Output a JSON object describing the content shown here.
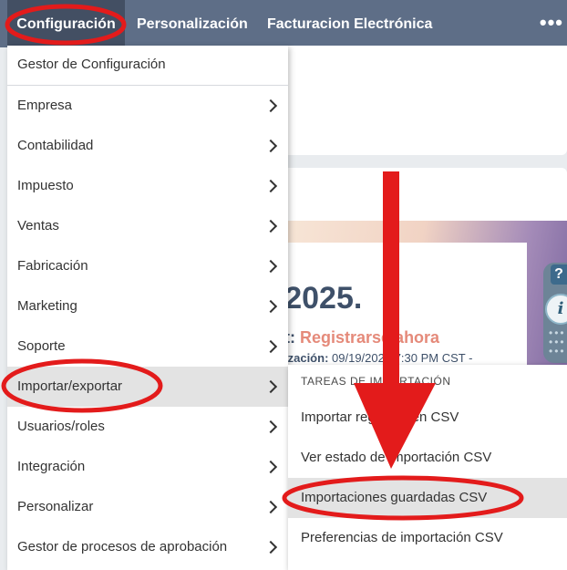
{
  "nav": {
    "items": [
      "Configuración",
      "Personalización",
      "Facturacion Electrónica"
    ],
    "more": "•••"
  },
  "background": {
    "title": "n 2025.",
    "promo_prefix": "t: ",
    "promo_link": "Registrarse ahora",
    "update_label": "ización:",
    "update_value": " 09/19/2025 7:30 PM CST -",
    "help": "?",
    "info": "i"
  },
  "menu": {
    "header": "Gestor de Configuración",
    "items": [
      "Empresa",
      "Contabilidad",
      "Impuesto",
      "Ventas",
      "Fabricación",
      "Marketing",
      "Soporte",
      "Importar/exportar",
      "Usuarios/roles",
      "Integración",
      "Personalizar",
      "Gestor de procesos de aprobación"
    ],
    "highlighted_index": 7
  },
  "submenu": {
    "header": "TAREAS DE IMPORTACIÓN",
    "items": [
      "Importar registros en CSV",
      "Ver estado de importación CSV",
      "Importaciones guardadas CSV",
      "Preferencias de importación CSV"
    ],
    "highlighted_index": 2
  },
  "annotation": {
    "color": "#e31b1b"
  }
}
